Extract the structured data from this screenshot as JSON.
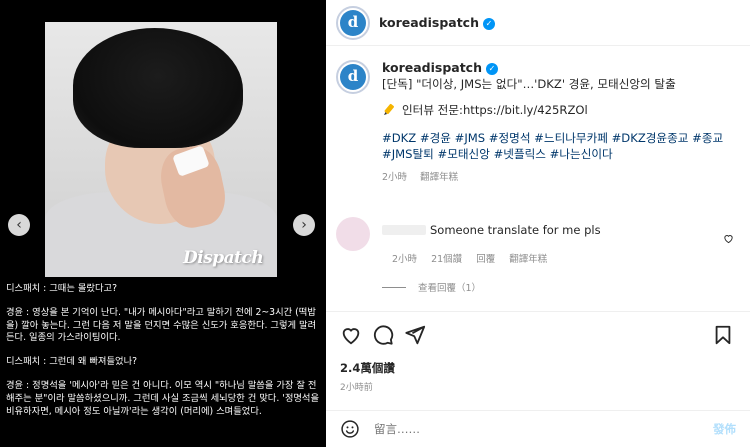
{
  "media": {
    "watermark": "Dispatch",
    "prev_label": "‹",
    "next_label": "›",
    "article": [
      "디스패치 : 그때는 몰랐다고?",
      "경윤 : 영상을 본 기억이 난다. \"내가 메시아다\"라고 말하기 전에 2~3시간 (떡밥을) 깔아 놓는다. 그런 다음 저 말을 던지면 수많은 신도가 호응한다. 그렇게 말려든다. 일종의 가스라이팅이다.",
      "디스패치 : 그런데 왜 빠져들었나?",
      "경윤 : 정명석을 '메시아'라 믿은 건 아니다. 이모 역시 \"하나님 말씀을 가장 잘 전해주는 분\"이라 말씀하셨으니까. 그런데 사실 조금씩 세뇌당한 건 맞다. '정명석을 비유하자면, 메시아 정도 아닐까'라는 생각이 (머리에) 스며들었다."
    ]
  },
  "post": {
    "username": "koreadispatch",
    "avatar_letter": "d",
    "caption_line1": "[단독] \"더이상, JMS는 없다\"…'DKZ' 경윤, 모태신앙의 탈출",
    "link_prefix": "인터뷰 전문: ",
    "link": "https://bit.ly/425RZOl",
    "hashtags_line1": "#DKZ #경윤 #JMS #정명석 #느티나무카페 #DKZ경윤종교 #종교",
    "hashtags_line2": "#JMS탈퇴 #모태신앙 #넷플릭스 #나는신이다",
    "caption_time": "2小時",
    "caption_translate": "翻譯年糕",
    "comment": {
      "text": "Someone translate for me pls",
      "time": "2小時",
      "likes": "21個讚",
      "reply": "回覆",
      "translate": "翻譯年糕",
      "view_replies": "查看回覆（1）"
    },
    "likes": "2.4萬個讚",
    "time": "2小時前",
    "add_comment_placeholder": "留言……",
    "post_label": "發佈"
  },
  "colors": {
    "verified": "#0095f6",
    "hashtag": "#00376b",
    "post_button": "#b2dffc",
    "avatar_brand": "#2c84c8"
  }
}
